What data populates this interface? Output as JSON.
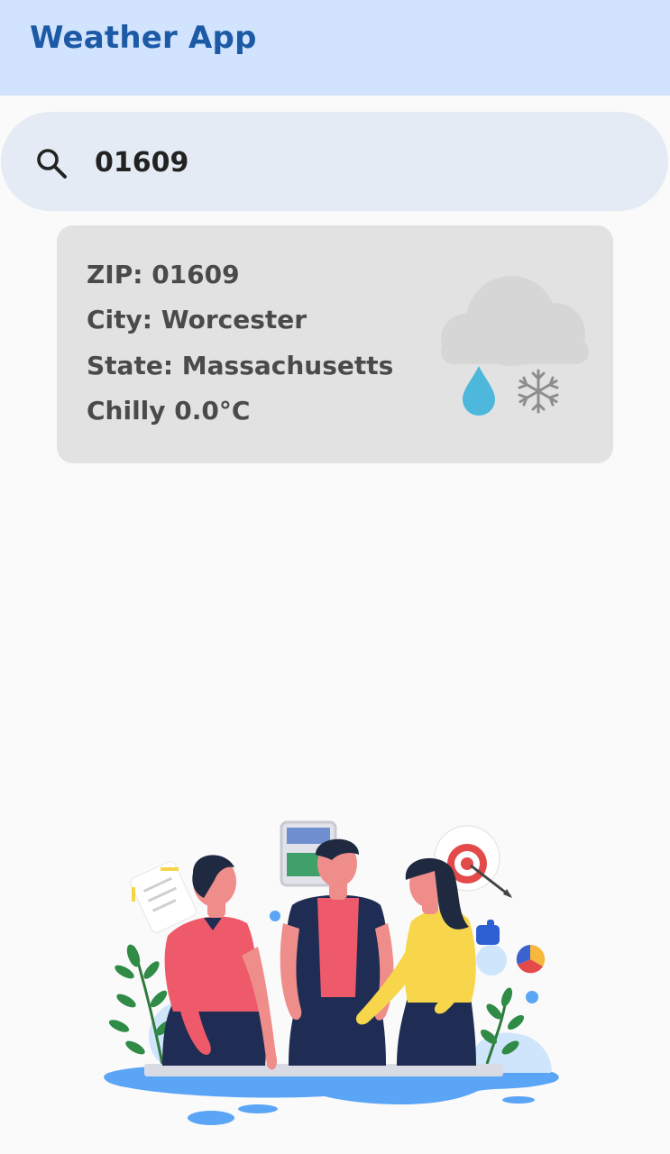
{
  "app_bar": {
    "title": "Weather App"
  },
  "search": {
    "icon": "search-icon",
    "value": "01609"
  },
  "weather_card": {
    "zip_line": "ZIP: 01609",
    "city_line": "City: Worcester",
    "state_line": "State: Massachusetts",
    "condition_line": "Chilly 0.0°C",
    "icons": [
      "cloud-icon",
      "water-drop-icon",
      "snowflake-icon"
    ]
  },
  "colors": {
    "app_bar_bg": "#d1e3fd",
    "title": "#1c5aa6",
    "search_bg": "#e4ebf4",
    "card_bg": "#e2e2e2",
    "card_text": "#4a4a4a",
    "drop": "#4db8db",
    "snow": "#8d8d8d"
  }
}
